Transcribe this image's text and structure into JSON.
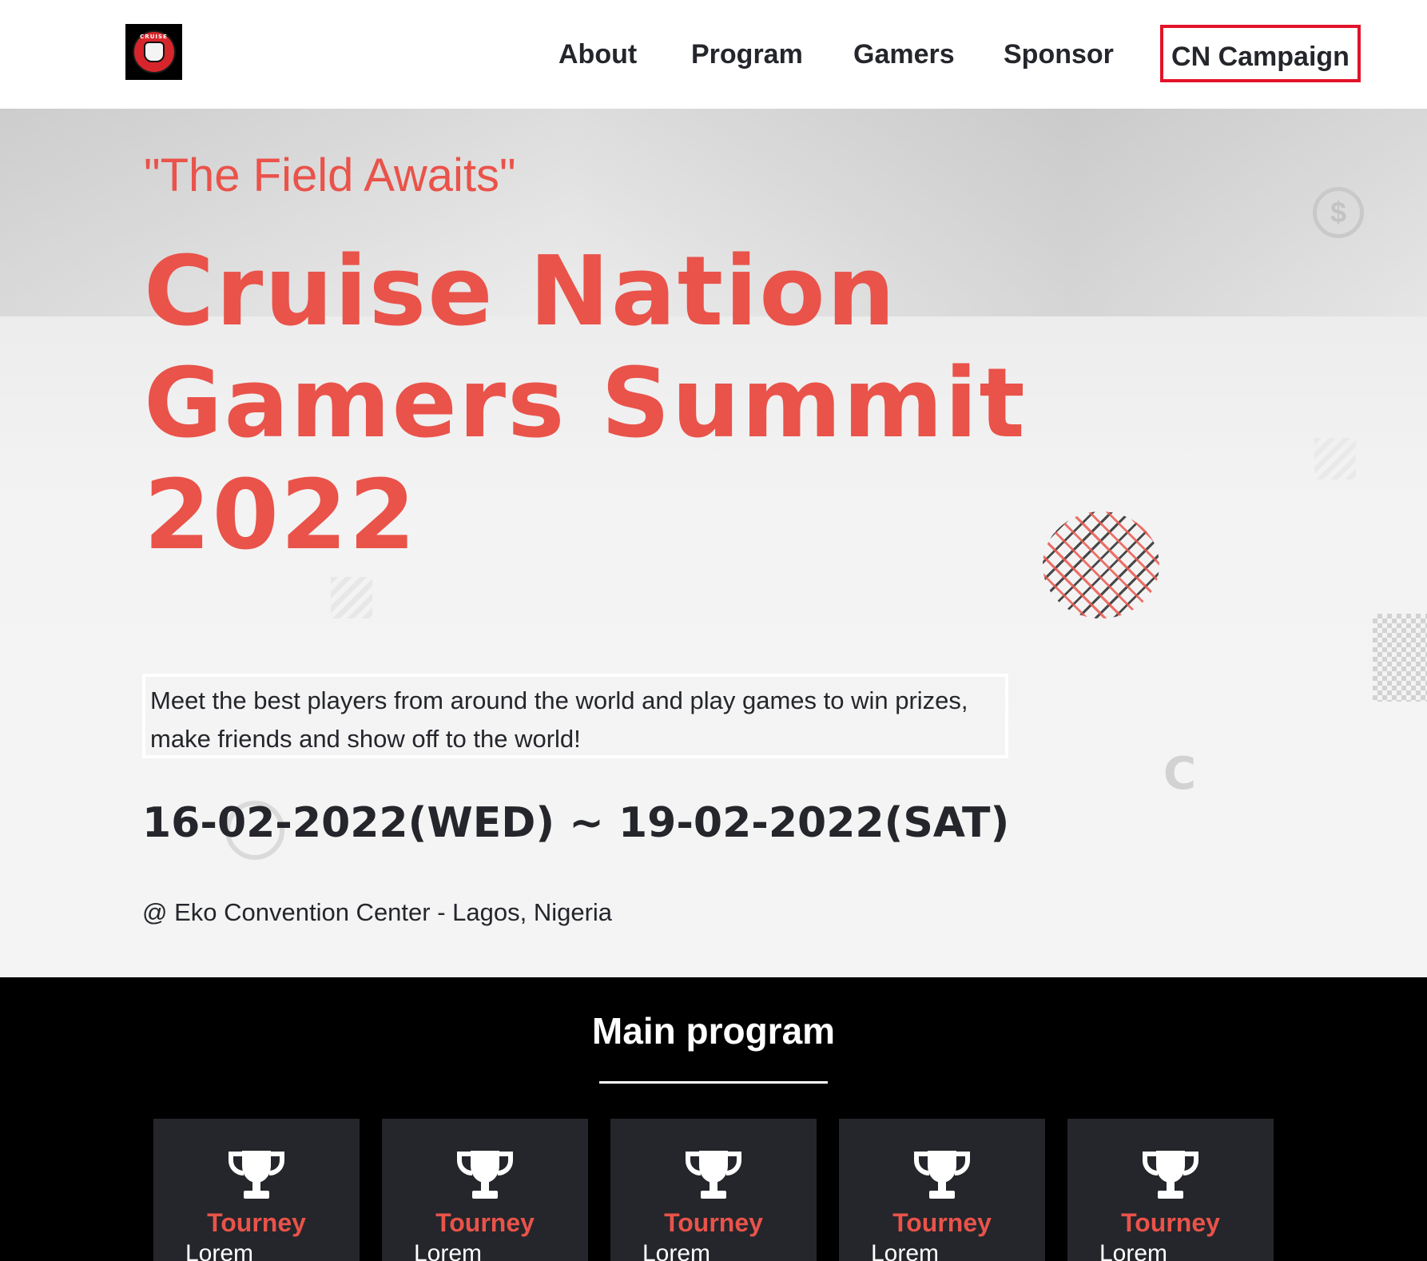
{
  "header": {
    "logo_text": "CRUISE",
    "nav": {
      "about": "About",
      "program": "Program",
      "gamers": "Gamers",
      "sponsor": "Sponsor",
      "campaign": "CN Campaign"
    }
  },
  "hero": {
    "tagline": "\"The Field Awaits\"",
    "title_lines": [
      "Cruise Nation",
      "Gamers Summit",
      "2022"
    ],
    "description": "Meet the best players from around the world and play games to win prizes, make friends and show off to the world!",
    "dates": "16-02-2022(WED) ~ 19-02-2022(SAT)",
    "venue": "@ Eko Convention Center - Lagos, Nigeria"
  },
  "program": {
    "title": "Main program",
    "cards": [
      {
        "title": "Tourney",
        "text": "Lorem",
        "icon": "trophy-icon"
      },
      {
        "title": "Tourney",
        "text": "Lorem",
        "icon": "trophy-icon"
      },
      {
        "title": "Tourney",
        "text": "Lorem",
        "icon": "trophy-icon"
      },
      {
        "title": "Tourney",
        "text": "Lorem",
        "icon": "trophy-icon"
      },
      {
        "title": "Tourney",
        "text": "Lorem",
        "icon": "trophy-icon"
      }
    ]
  },
  "colors": {
    "accent": "#e9534a",
    "dark": "#24262b",
    "highlight_border": "#e2132a"
  }
}
